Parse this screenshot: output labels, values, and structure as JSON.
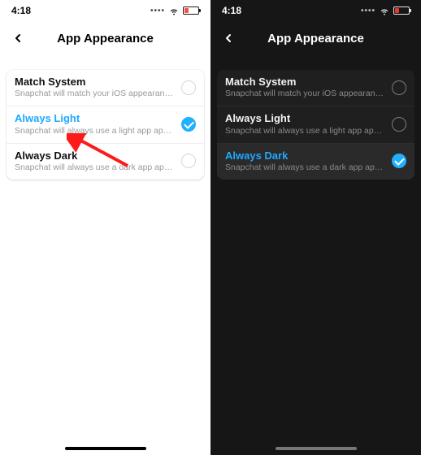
{
  "status": {
    "time": "4:18"
  },
  "nav": {
    "title": "App Appearance"
  },
  "options": {
    "match": {
      "title": "Match System",
      "subtitle": "Snapchat will match your iOS appearance setti…"
    },
    "light": {
      "title": "Always Light",
      "subtitle": "Snapchat will always use a light app appearance."
    },
    "dark": {
      "title": "Always Dark",
      "subtitle": "Snapchat will always use a dark app appearance."
    }
  },
  "left_screen": {
    "selected": "light"
  },
  "right_screen": {
    "selected": "dark"
  },
  "colors": {
    "accent": "#1fb0ff",
    "active_text": "#1fa8ff",
    "battery_low": "#ff3b30"
  }
}
